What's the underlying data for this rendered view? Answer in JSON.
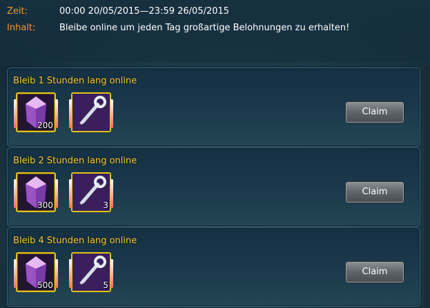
{
  "header": {
    "time_key": "Zeit:",
    "time_value": "00:00 20/05/2015—23:59 26/05/2015",
    "content_key": "Inhalt:",
    "content_value": "Bleibe online um jeden Tag großartige Belohnungen zu erhalten!"
  },
  "rewards": [
    {
      "title": "Bleib 1 Stunden lang online",
      "crystal_count": "200",
      "key_count": "",
      "claim_label": "Claim"
    },
    {
      "title": "Bleib 2 Stunden lang online",
      "crystal_count": "300",
      "key_count": "3",
      "claim_label": "Claim"
    },
    {
      "title": "Bleib 4 Stunden lang online",
      "crystal_count": "500",
      "key_count": "5",
      "claim_label": "Claim"
    }
  ],
  "icons": {
    "crystal": "purple-crystal-icon",
    "key": "silver-key-icon"
  },
  "colors": {
    "label_orange": "#f09a2c",
    "title_yellow": "#ffcc33",
    "item_border": "#e4c21a"
  }
}
